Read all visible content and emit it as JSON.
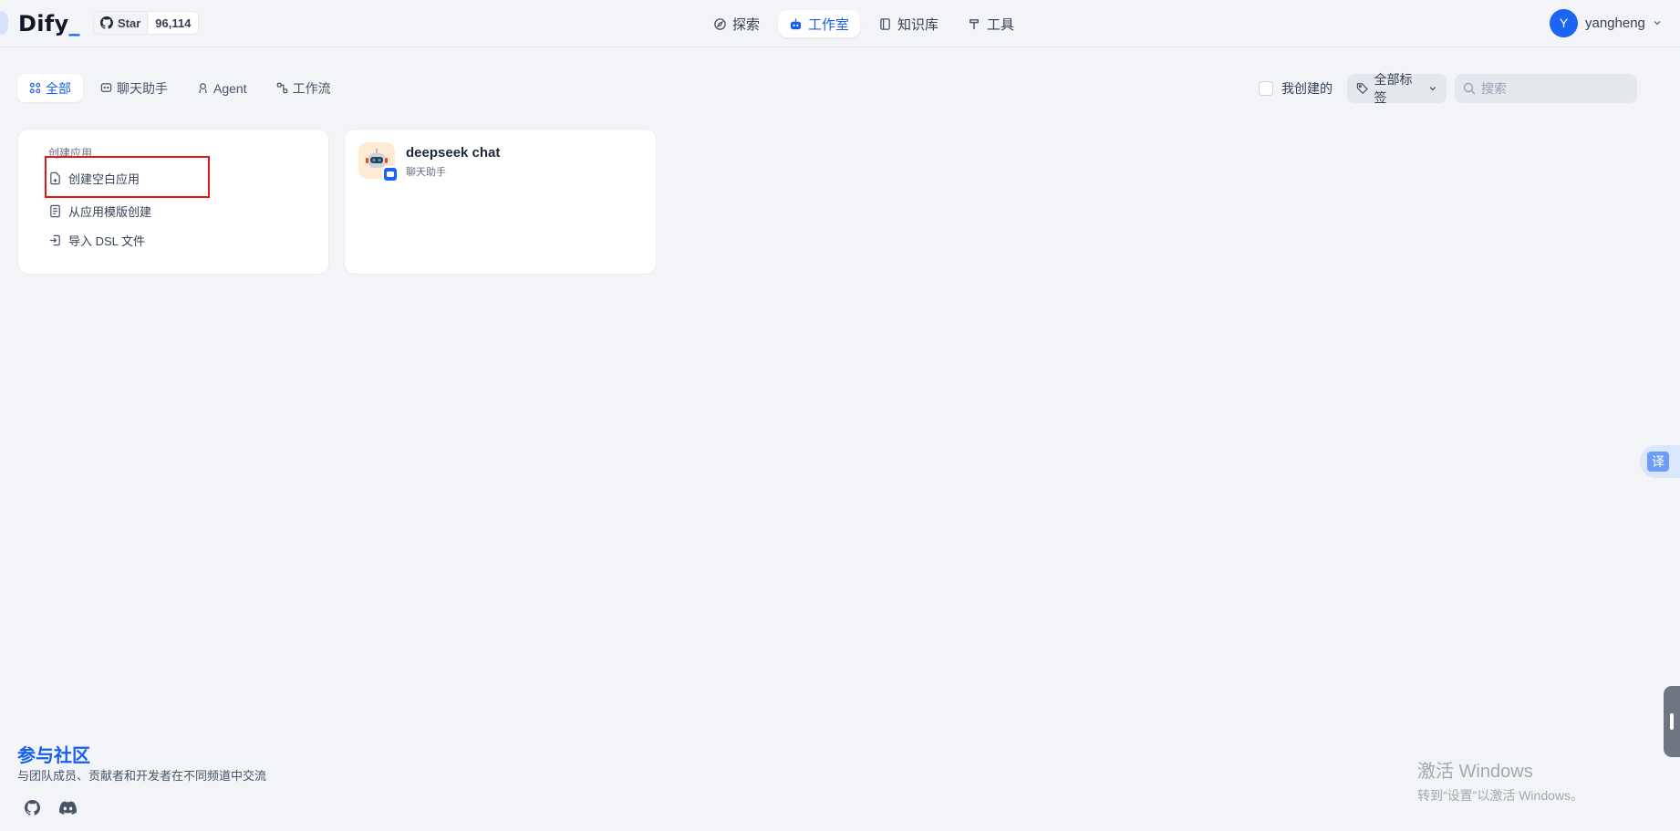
{
  "header": {
    "logo": "Dify",
    "logo_dot": "_",
    "github": {
      "label": "Star",
      "count": "96,114"
    },
    "nav": [
      {
        "label": "探索",
        "icon": "compass-icon"
      },
      {
        "label": "工作室",
        "icon": "robot-icon",
        "active": true
      },
      {
        "label": "知识库",
        "icon": "book-icon"
      },
      {
        "label": "工具",
        "icon": "hammer-icon"
      }
    ],
    "user": {
      "initial": "Y",
      "name": "yangheng"
    }
  },
  "filters": {
    "tabs": [
      {
        "label": "全部",
        "active": true
      },
      {
        "label": "聊天助手"
      },
      {
        "label": "Agent"
      },
      {
        "label": "工作流"
      }
    ],
    "mine_label": "我创建的",
    "tag_label": "全部标签",
    "search_placeholder": "搜索"
  },
  "create_card": {
    "title": "创建应用",
    "items": [
      {
        "label": "创建空白应用",
        "icon": "file-plus-icon"
      },
      {
        "label": "从应用模版创建",
        "icon": "template-icon"
      },
      {
        "label": "导入 DSL 文件",
        "icon": "import-icon"
      }
    ]
  },
  "apps": [
    {
      "name": "deepseek chat",
      "type": "聊天助手"
    }
  ],
  "footer": {
    "title": "参与社区",
    "description": "与团队成员、贡献者和开发者在不同频道中交流"
  },
  "watermark": {
    "line1": "激活 Windows",
    "line2": "转到“设置”以激活 Windows。"
  },
  "translate_button": "译",
  "colors": {
    "accent": "#155eef",
    "highlight": "#e01818",
    "background": "#f2f4f7"
  }
}
